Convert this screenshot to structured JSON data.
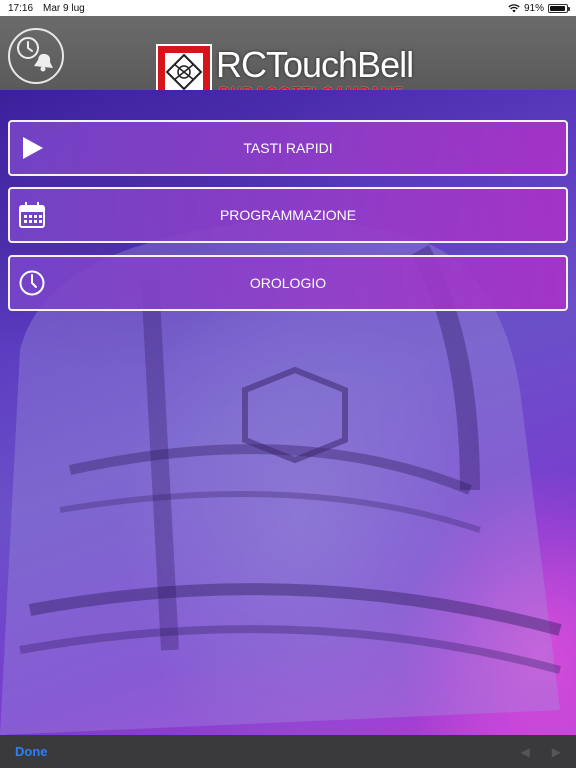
{
  "status_bar": {
    "time": "17:16",
    "date": "Mar 9 lug",
    "battery_percent": "91%",
    "battery_level": 0.91,
    "wifi_icon": "wifi-icon"
  },
  "header": {
    "logo_title": "RCTouchBell",
    "logo_subtitle": "RUBAGOTTI CAMPANE",
    "left_button_icon": "clock-bell-icon"
  },
  "menu": {
    "items": [
      {
        "label": "TASTI RAPIDI",
        "icon": "play-icon"
      },
      {
        "label": "PROGRAMMAZIONE",
        "icon": "calendar-icon"
      },
      {
        "label": "OROLOGIO",
        "icon": "clock-icon"
      }
    ]
  },
  "toolbar": {
    "done_label": "Done",
    "prev_glyph": "◀",
    "next_glyph": "▶"
  },
  "colors": {
    "header_bg": "#5f5f5f",
    "accent_purple": "#9a46c8",
    "logo_red": "#d6151a",
    "done_blue": "#2f7ff0"
  }
}
